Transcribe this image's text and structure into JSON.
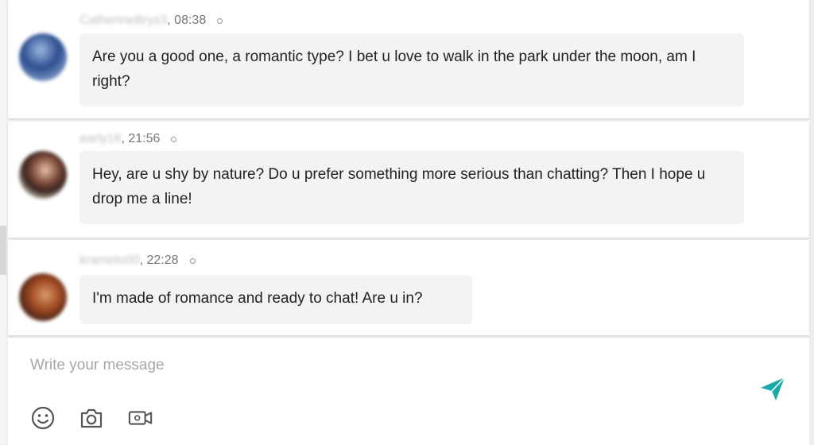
{
  "messages": [
    {
      "username": "CatherineBrys3",
      "time": "08:38",
      "text": "Are you a good one, a romantic type? I bet u love to walk in the park under the moon, am I right?"
    },
    {
      "username": "early16",
      "time": "21:56",
      "text": "Hey, are u shy by nature? Do u prefer something more serious than chatting? Then I hope u drop me a line!"
    },
    {
      "username": "krameto00",
      "time": "22:28",
      "text": "I'm made of romance and ready to chat! Are u in?"
    }
  ],
  "composer": {
    "placeholder": "Write your message",
    "value": ""
  },
  "colors": {
    "send": "#1aa9a9",
    "bubble": "#f3f3f3"
  },
  "icons": [
    "emoji-icon",
    "camera-icon",
    "video-icon",
    "send-icon"
  ]
}
